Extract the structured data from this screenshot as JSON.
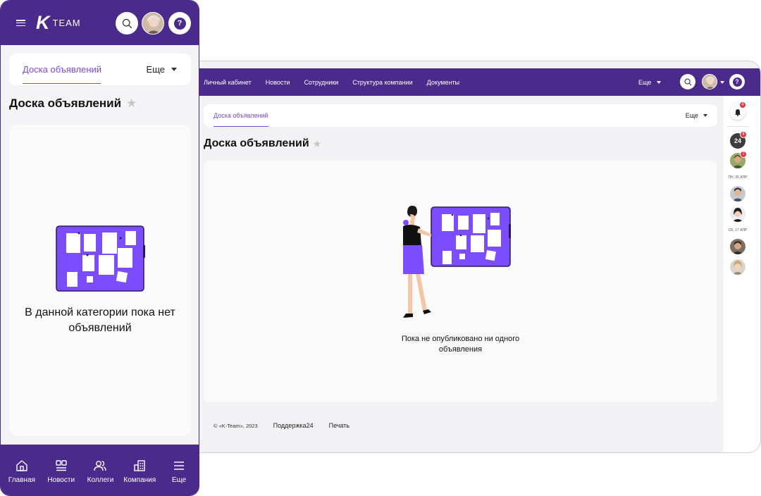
{
  "brand": {
    "mark": "K",
    "name": "TEAM"
  },
  "colors": {
    "primary": "#4a2a8a",
    "accent": "#7a4ad8",
    "illustration": "#7c4dff",
    "badge": "#e53946"
  },
  "desktop": {
    "nav": [
      "Личный кабинет",
      "Новости",
      "Сотрудники",
      "Структура компании",
      "Документы"
    ],
    "nav_more": "Еще",
    "tab_active": "Доска объявлений",
    "tab_more": "Еще",
    "page_title": "Доска объявлений",
    "empty_message": "Пока не опубликовано ни одного объявления",
    "footer": {
      "copyright": "© «K-Team», 2023",
      "support": "Поддержка24",
      "print": "Печать"
    },
    "sidebar": {
      "notifications_badge": "4",
      "b24_label": "24",
      "b24_badge": "4",
      "user_badge": "7",
      "date_1": "ПН, 26 АПР",
      "date_2": "СБ, 17 АПР"
    }
  },
  "mobile": {
    "tab_active": "Доска объявлений",
    "tab_more": "Еще",
    "page_title": "Доска объявлений",
    "empty_message": "В данной категории пока нет объявлений",
    "bottom_nav": [
      {
        "label": "Главная",
        "icon": "home-icon"
      },
      {
        "label": "Новости",
        "icon": "news-icon"
      },
      {
        "label": "Коллеги",
        "icon": "colleagues-icon"
      },
      {
        "label": "Компания",
        "icon": "company-icon"
      },
      {
        "label": "Еще",
        "icon": "menu-icon"
      }
    ]
  }
}
